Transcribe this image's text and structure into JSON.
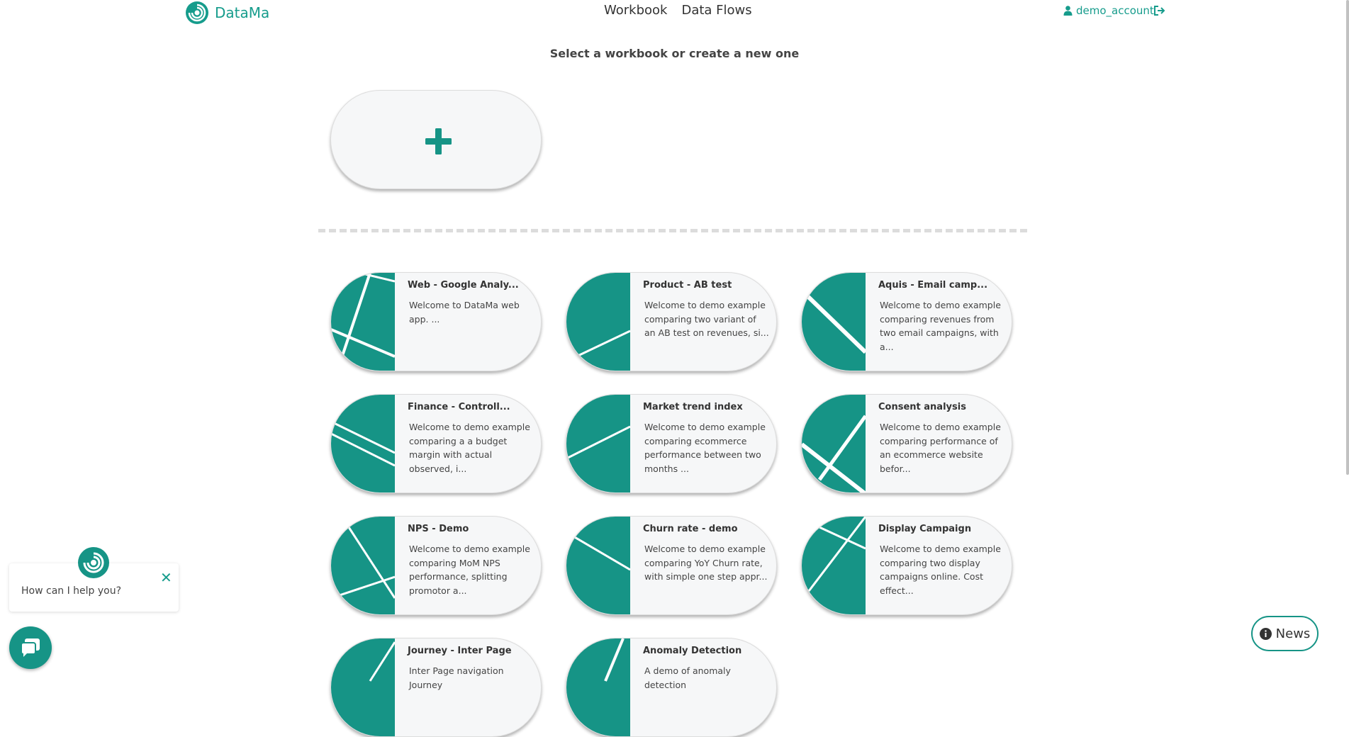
{
  "header": {
    "brand": "DataMa",
    "nav": [
      "Workbook",
      "Data Flows"
    ],
    "user": "demo_account"
  },
  "subtitle": "Select a workbook or create a new one",
  "cards": [
    {
      "title": "Web - Google Analy...",
      "desc": "Welcome to DataMa    web app.              ..."
    },
    {
      "title": "Product - AB test",
      "desc": "Welcome to demo example comparing two variant of an AB test on revenues, si..."
    },
    {
      "title": "Aquis - Email camp...",
      "desc": "Welcome to demo example comparing revenues from two email campaigns, with a..."
    },
    {
      "title": "Finance - Controll...",
      "desc": "Welcome to demo example comparing a a budget margin with actual observed, i..."
    },
    {
      "title": "Market trend index",
      "desc": "Welcome to demo example comparing ecommerce performance between two months ..."
    },
    {
      "title": "Consent analysis",
      "desc": "Welcome to demo example comparing performance of an ecommerce website befor..."
    },
    {
      "title": "NPS - Demo",
      "desc": "Welcome to demo example comparing MoM NPS performance, splitting promotor a..."
    },
    {
      "title": "Churn rate - demo",
      "desc": "Welcome to demo example comparing YoY Churn rate, with simple one step appr..."
    },
    {
      "title": "Display Campaign",
      "desc": "Welcome to demo example comparing two display campaigns online. Cost effect..."
    },
    {
      "title": "Journey - Inter Page",
      "desc": "Inter Page navigation Journey"
    },
    {
      "title": "Anomaly Detection",
      "desc": "A demo of anomaly detection"
    }
  ],
  "chat": {
    "prompt": "How can I help you?"
  },
  "news": {
    "label": "News"
  },
  "colors": {
    "accent": "#169486",
    "brand": "#169c8c"
  }
}
